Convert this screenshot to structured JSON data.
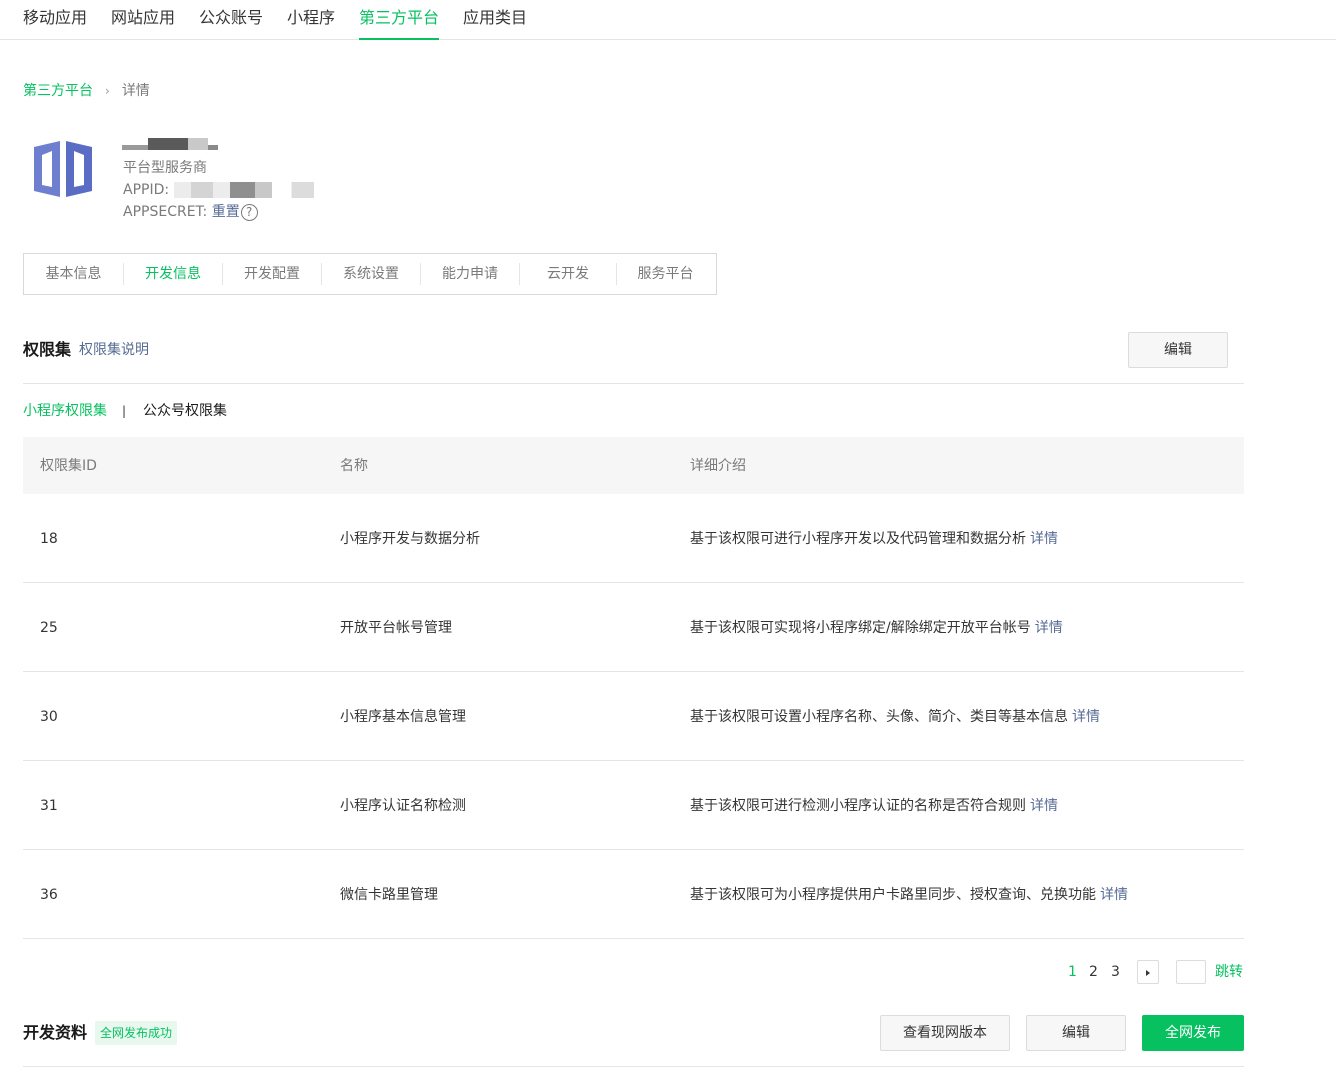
{
  "topnav": {
    "items": [
      {
        "label": "移动应用"
      },
      {
        "label": "网站应用"
      },
      {
        "label": "公众账号"
      },
      {
        "label": "小程序"
      },
      {
        "label": "第三方平台",
        "active": true
      },
      {
        "label": "应用类目"
      }
    ]
  },
  "breadcrumb": {
    "parent": "第三方平台",
    "separator": "›",
    "current": "详情"
  },
  "app": {
    "type": "平台型服务商",
    "appid_label": "APPID:",
    "appsecret_label": "APPSECRET:",
    "reset_label": "重置",
    "help_icon": "?",
    "logo_icon": "app-logo-icon"
  },
  "subtabs": [
    {
      "label": "基本信息"
    },
    {
      "label": "开发信息",
      "active": true
    },
    {
      "label": "开发配置"
    },
    {
      "label": "系统设置"
    },
    {
      "label": "能力申请"
    },
    {
      "label": "云开发"
    },
    {
      "label": "服务平台"
    }
  ],
  "permissions": {
    "title": "权限集",
    "explain_link": "权限集说明",
    "edit_button": "编辑",
    "tabs": [
      {
        "label": "小程序权限集",
        "active": true
      },
      {
        "label": "公众号权限集"
      }
    ],
    "tab_separator": "|",
    "columns": [
      "权限集ID",
      "名称",
      "详细介绍"
    ],
    "rows": [
      {
        "id": "18",
        "name": "小程序开发与数据分析",
        "desc": "基于该权限可进行小程序开发以及代码管理和数据分析",
        "link": "详情"
      },
      {
        "id": "25",
        "name": "开放平台帐号管理",
        "desc": "基于该权限可实现将小程序绑定/解除绑定开放平台帐号",
        "link": "详情"
      },
      {
        "id": "30",
        "name": "小程序基本信息管理",
        "desc": "基于该权限可设置小程序名称、头像、简介、类目等基本信息",
        "link": "详情"
      },
      {
        "id": "31",
        "name": "小程序认证名称检测",
        "desc": "基于该权限可进行检测小程序认证的名称是否符合规则",
        "link": "详情"
      },
      {
        "id": "36",
        "name": "微信卡路里管理",
        "desc": "基于该权限可为小程序提供用户卡路里同步、授权查询、兑换功能",
        "link": "详情"
      }
    ],
    "pagination": {
      "pages": [
        "1",
        "2",
        "3"
      ],
      "current": "1",
      "jump_label": "跳转"
    }
  },
  "dev_material": {
    "title": "开发资料",
    "status_badge": "全网发布成功",
    "view_version_button": "查看现网版本",
    "edit_button": "编辑",
    "publish_button": "全网发布"
  },
  "colors": {
    "accent": "#07c160",
    "link": "#576b95"
  }
}
